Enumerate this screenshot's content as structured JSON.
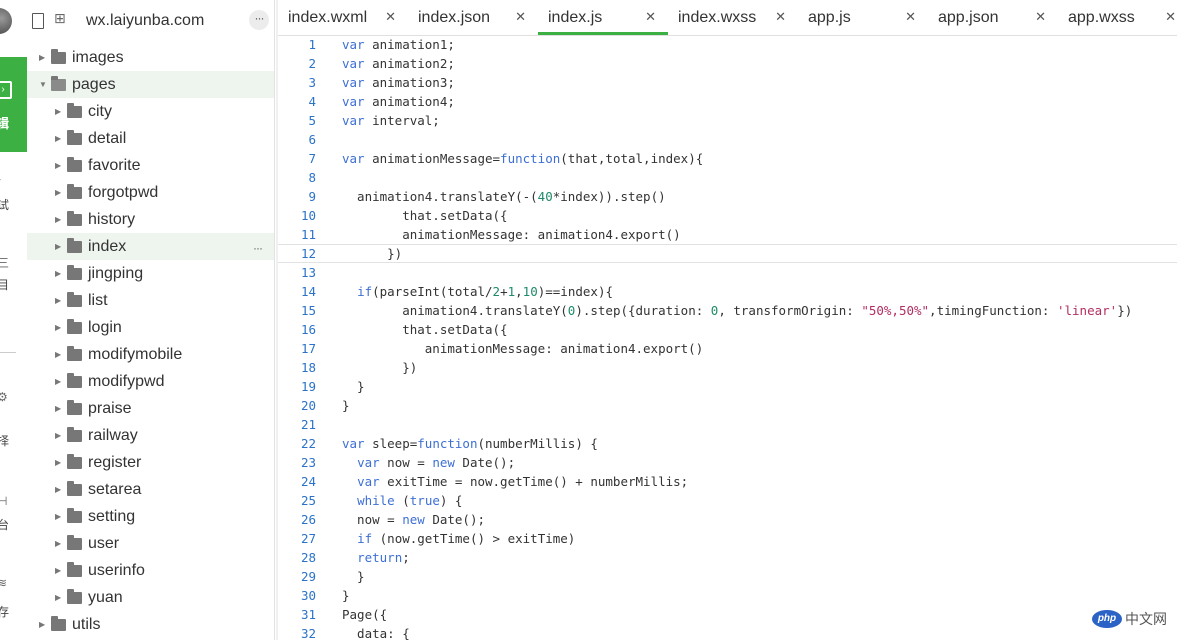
{
  "sidebar_strip": {
    "edit_label": "辑",
    "fragments": [
      "试",
      "目",
      "择",
      "台",
      "存"
    ]
  },
  "explorer": {
    "project_title": "wx.laiyunba.com",
    "more_label": "···",
    "tree": [
      {
        "name": "images",
        "depth": 0,
        "open": false,
        "active": false
      },
      {
        "name": "pages",
        "depth": 0,
        "open": true,
        "active": true
      },
      {
        "name": "city",
        "depth": 1,
        "open": false,
        "active": false
      },
      {
        "name": "detail",
        "depth": 1,
        "open": false,
        "active": false
      },
      {
        "name": "favorite",
        "depth": 1,
        "open": false,
        "active": false
      },
      {
        "name": "forgotpwd",
        "depth": 1,
        "open": false,
        "active": false
      },
      {
        "name": "history",
        "depth": 1,
        "open": false,
        "active": false
      },
      {
        "name": "index",
        "depth": 1,
        "open": false,
        "active": true,
        "more": "···"
      },
      {
        "name": "jingping",
        "depth": 1,
        "open": false,
        "active": false
      },
      {
        "name": "list",
        "depth": 1,
        "open": false,
        "active": false
      },
      {
        "name": "login",
        "depth": 1,
        "open": false,
        "active": false
      },
      {
        "name": "modifymobile",
        "depth": 1,
        "open": false,
        "active": false
      },
      {
        "name": "modifypwd",
        "depth": 1,
        "open": false,
        "active": false
      },
      {
        "name": "praise",
        "depth": 1,
        "open": false,
        "active": false
      },
      {
        "name": "railway",
        "depth": 1,
        "open": false,
        "active": false
      },
      {
        "name": "register",
        "depth": 1,
        "open": false,
        "active": false
      },
      {
        "name": "setarea",
        "depth": 1,
        "open": false,
        "active": false
      },
      {
        "name": "setting",
        "depth": 1,
        "open": false,
        "active": false
      },
      {
        "name": "user",
        "depth": 1,
        "open": false,
        "active": false
      },
      {
        "name": "userinfo",
        "depth": 1,
        "open": false,
        "active": false
      },
      {
        "name": "yuan",
        "depth": 1,
        "open": false,
        "active": false
      },
      {
        "name": "utils",
        "depth": 0,
        "open": false,
        "active": false
      }
    ]
  },
  "editor": {
    "tabs": [
      {
        "label": "index.wxml",
        "active": false,
        "close": "✕"
      },
      {
        "label": "index.json",
        "active": false,
        "close": "✕"
      },
      {
        "label": "index.js",
        "active": true,
        "close": "✕"
      },
      {
        "label": "index.wxss",
        "active": false,
        "close": "✕"
      },
      {
        "label": "app.js",
        "active": false,
        "close": "✕"
      },
      {
        "label": "app.json",
        "active": false,
        "close": "✕"
      },
      {
        "label": "app.wxss",
        "active": false,
        "close": "✕"
      }
    ],
    "current_line": 12,
    "lines": [
      {
        "n": "1",
        "code": "var animation1;"
      },
      {
        "n": "2",
        "code": "var animation2;"
      },
      {
        "n": "3",
        "code": "var animation3;"
      },
      {
        "n": "4",
        "code": "var animation4;"
      },
      {
        "n": "5",
        "code": "var interval;"
      },
      {
        "n": "6",
        "code": ""
      },
      {
        "n": "7",
        "code": "var animationMessage=function(that,total,index){"
      },
      {
        "n": "8",
        "code": ""
      },
      {
        "n": "9",
        "code": "  animation4.translateY(-(40*index)).step()"
      },
      {
        "n": "10",
        "code": "        that.setData({"
      },
      {
        "n": "11",
        "code": "        animationMessage: animation4.export()"
      },
      {
        "n": "12",
        "code": "      })"
      },
      {
        "n": "13",
        "code": ""
      },
      {
        "n": "14",
        "code": "  if(parseInt(total/2+1,10)==index){"
      },
      {
        "n": "15",
        "code": "        animation4.translateY(0).step({duration: 0, transformOrigin: \"50%,50%\",timingFunction: 'linear'})"
      },
      {
        "n": "16",
        "code": "        that.setData({"
      },
      {
        "n": "17",
        "code": "           animationMessage: animation4.export()"
      },
      {
        "n": "18",
        "code": "        })"
      },
      {
        "n": "19",
        "code": "  }"
      },
      {
        "n": "20",
        "code": "}"
      },
      {
        "n": "21",
        "code": ""
      },
      {
        "n": "22",
        "code": "var sleep=function(numberMillis) {"
      },
      {
        "n": "23",
        "code": "  var now = new Date();"
      },
      {
        "n": "24",
        "code": "  var exitTime = now.getTime() + numberMillis;"
      },
      {
        "n": "25",
        "code": "  while (true) {"
      },
      {
        "n": "26",
        "code": "  now = new Date();"
      },
      {
        "n": "27",
        "code": "  if (now.getTime() > exitTime)"
      },
      {
        "n": "28",
        "code": "  return;"
      },
      {
        "n": "29",
        "code": "  }"
      },
      {
        "n": "30",
        "code": "}"
      },
      {
        "n": "31",
        "code": "Page({"
      },
      {
        "n": "32",
        "code": "  data: {"
      }
    ]
  },
  "watermark": {
    "badge": "php",
    "text": "中文网"
  },
  "colors": {
    "accent": "#3cb043",
    "keyword": "#3d6fd3",
    "number": "#1f8a69",
    "string": "#b32d61",
    "line_number": "#2b73c9"
  }
}
